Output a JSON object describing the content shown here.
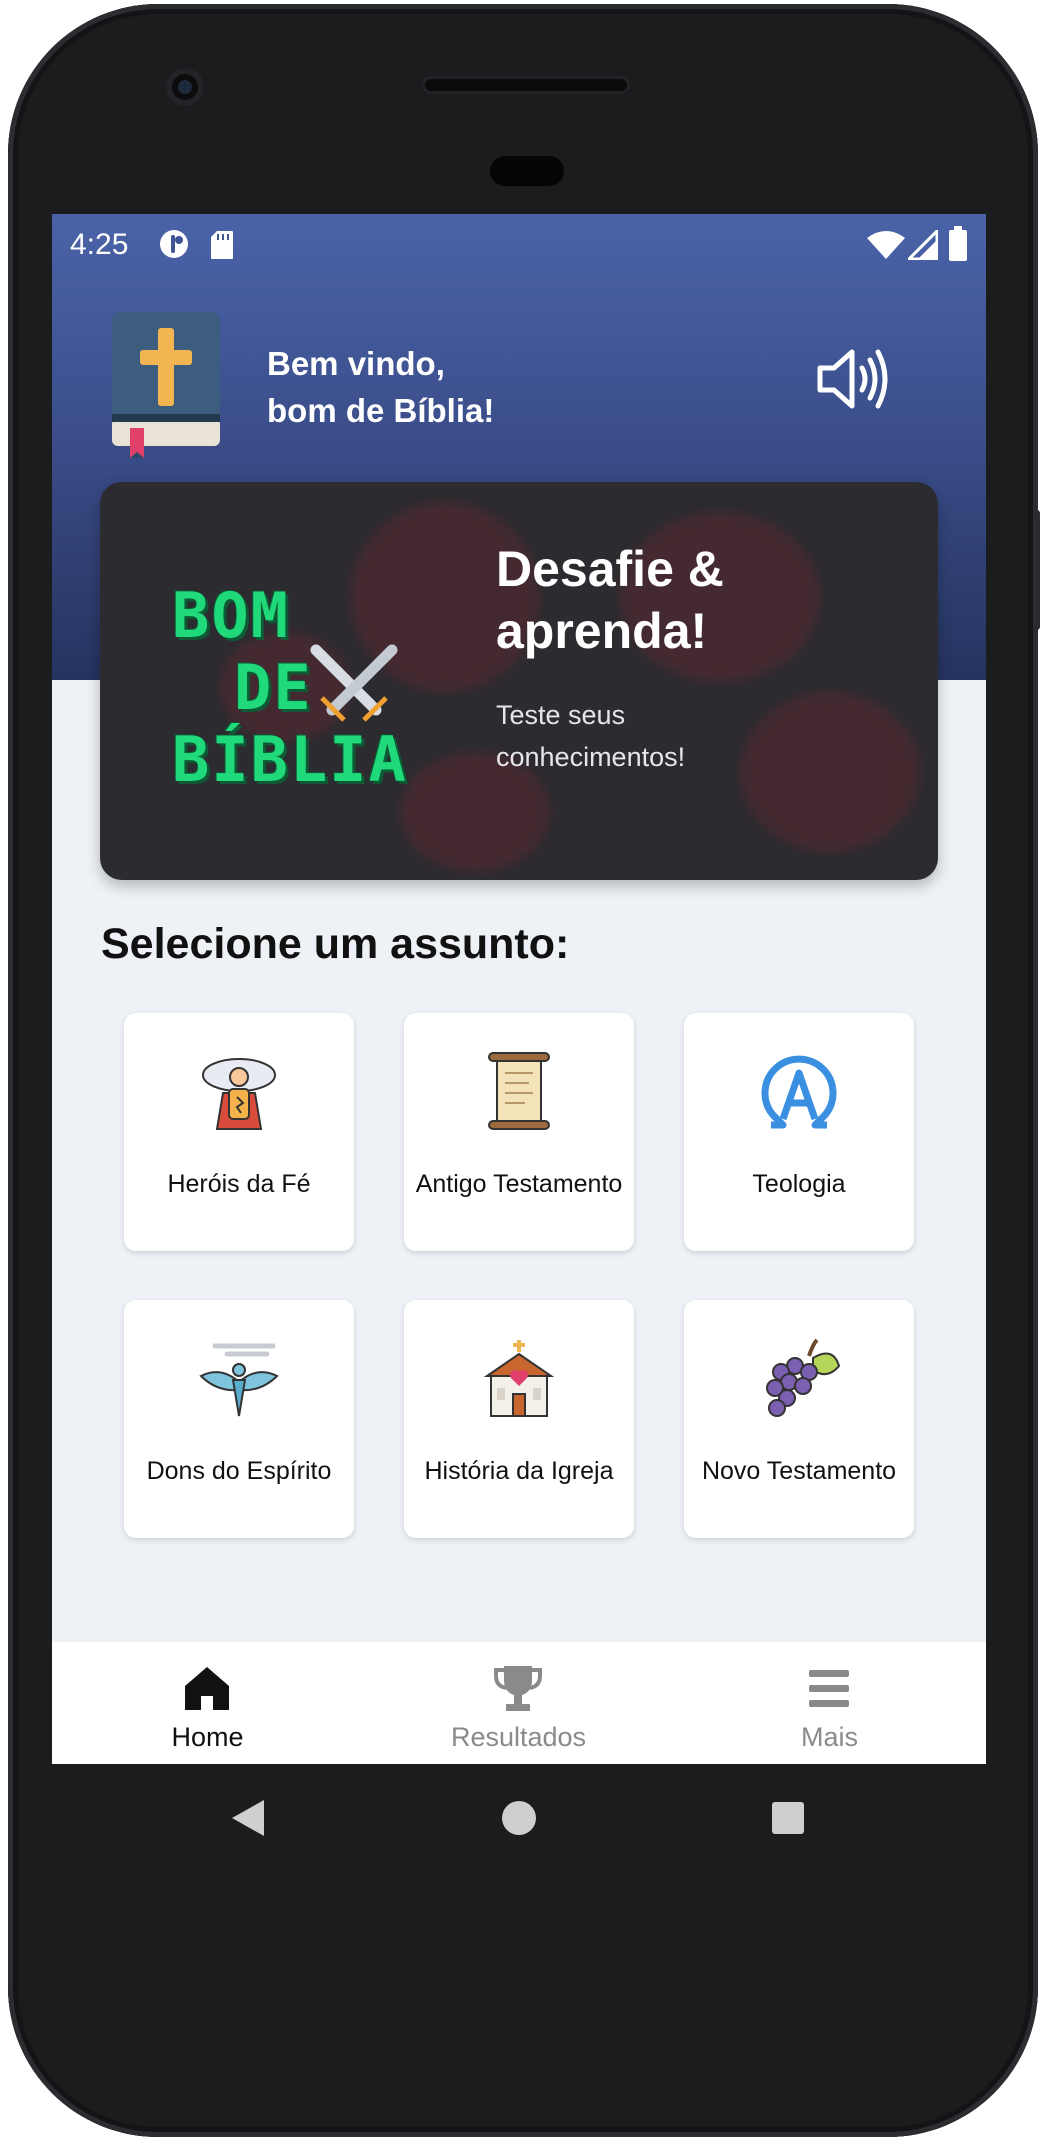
{
  "status_bar": {
    "time": "4:25",
    "icons": [
      "notification-icon",
      "sd-card-icon",
      "wifi-icon",
      "signal-icon",
      "battery-icon"
    ]
  },
  "header": {
    "greeting_line1": "Bem vindo,",
    "greeting_line2": "bom de Bíblia!",
    "logo_icon": "bible-icon",
    "sound_icon": "speaker-icon"
  },
  "banner": {
    "logo_lines": [
      "BOM",
      "DE",
      "BÍBLIA"
    ],
    "title": "Desafie & aprenda!",
    "subtitle": "Teste seus\n conhecimentos!"
  },
  "section": {
    "title": "Selecione um assunto:"
  },
  "topics": [
    {
      "label": "Heróis da Fé",
      "icon": "hero-icon"
    },
    {
      "label": "Antigo Testamento",
      "icon": "scroll-icon"
    },
    {
      "label": "Teologia",
      "icon": "alpha-omega-icon"
    },
    {
      "label": "Dons do Espírito",
      "icon": "dove-icon"
    },
    {
      "label": "História da Igreja",
      "icon": "church-icon"
    },
    {
      "label": "Novo Testamento",
      "icon": "grapes-icon"
    }
  ],
  "bottom_nav": {
    "items": [
      {
        "label": "Home",
        "icon": "home-icon",
        "active": true
      },
      {
        "label": "Resultados",
        "icon": "trophy-icon",
        "active": false
      },
      {
        "label": "Mais",
        "icon": "menu-icon",
        "active": false
      }
    ]
  },
  "colors": {
    "header_top": "#4a63a8",
    "header_bottom": "#25335f",
    "logo_green": "#1fd97b",
    "theology_blue": "#3b8fe0",
    "nav_active": "#111111",
    "nav_inactive": "#8a8a8a"
  }
}
